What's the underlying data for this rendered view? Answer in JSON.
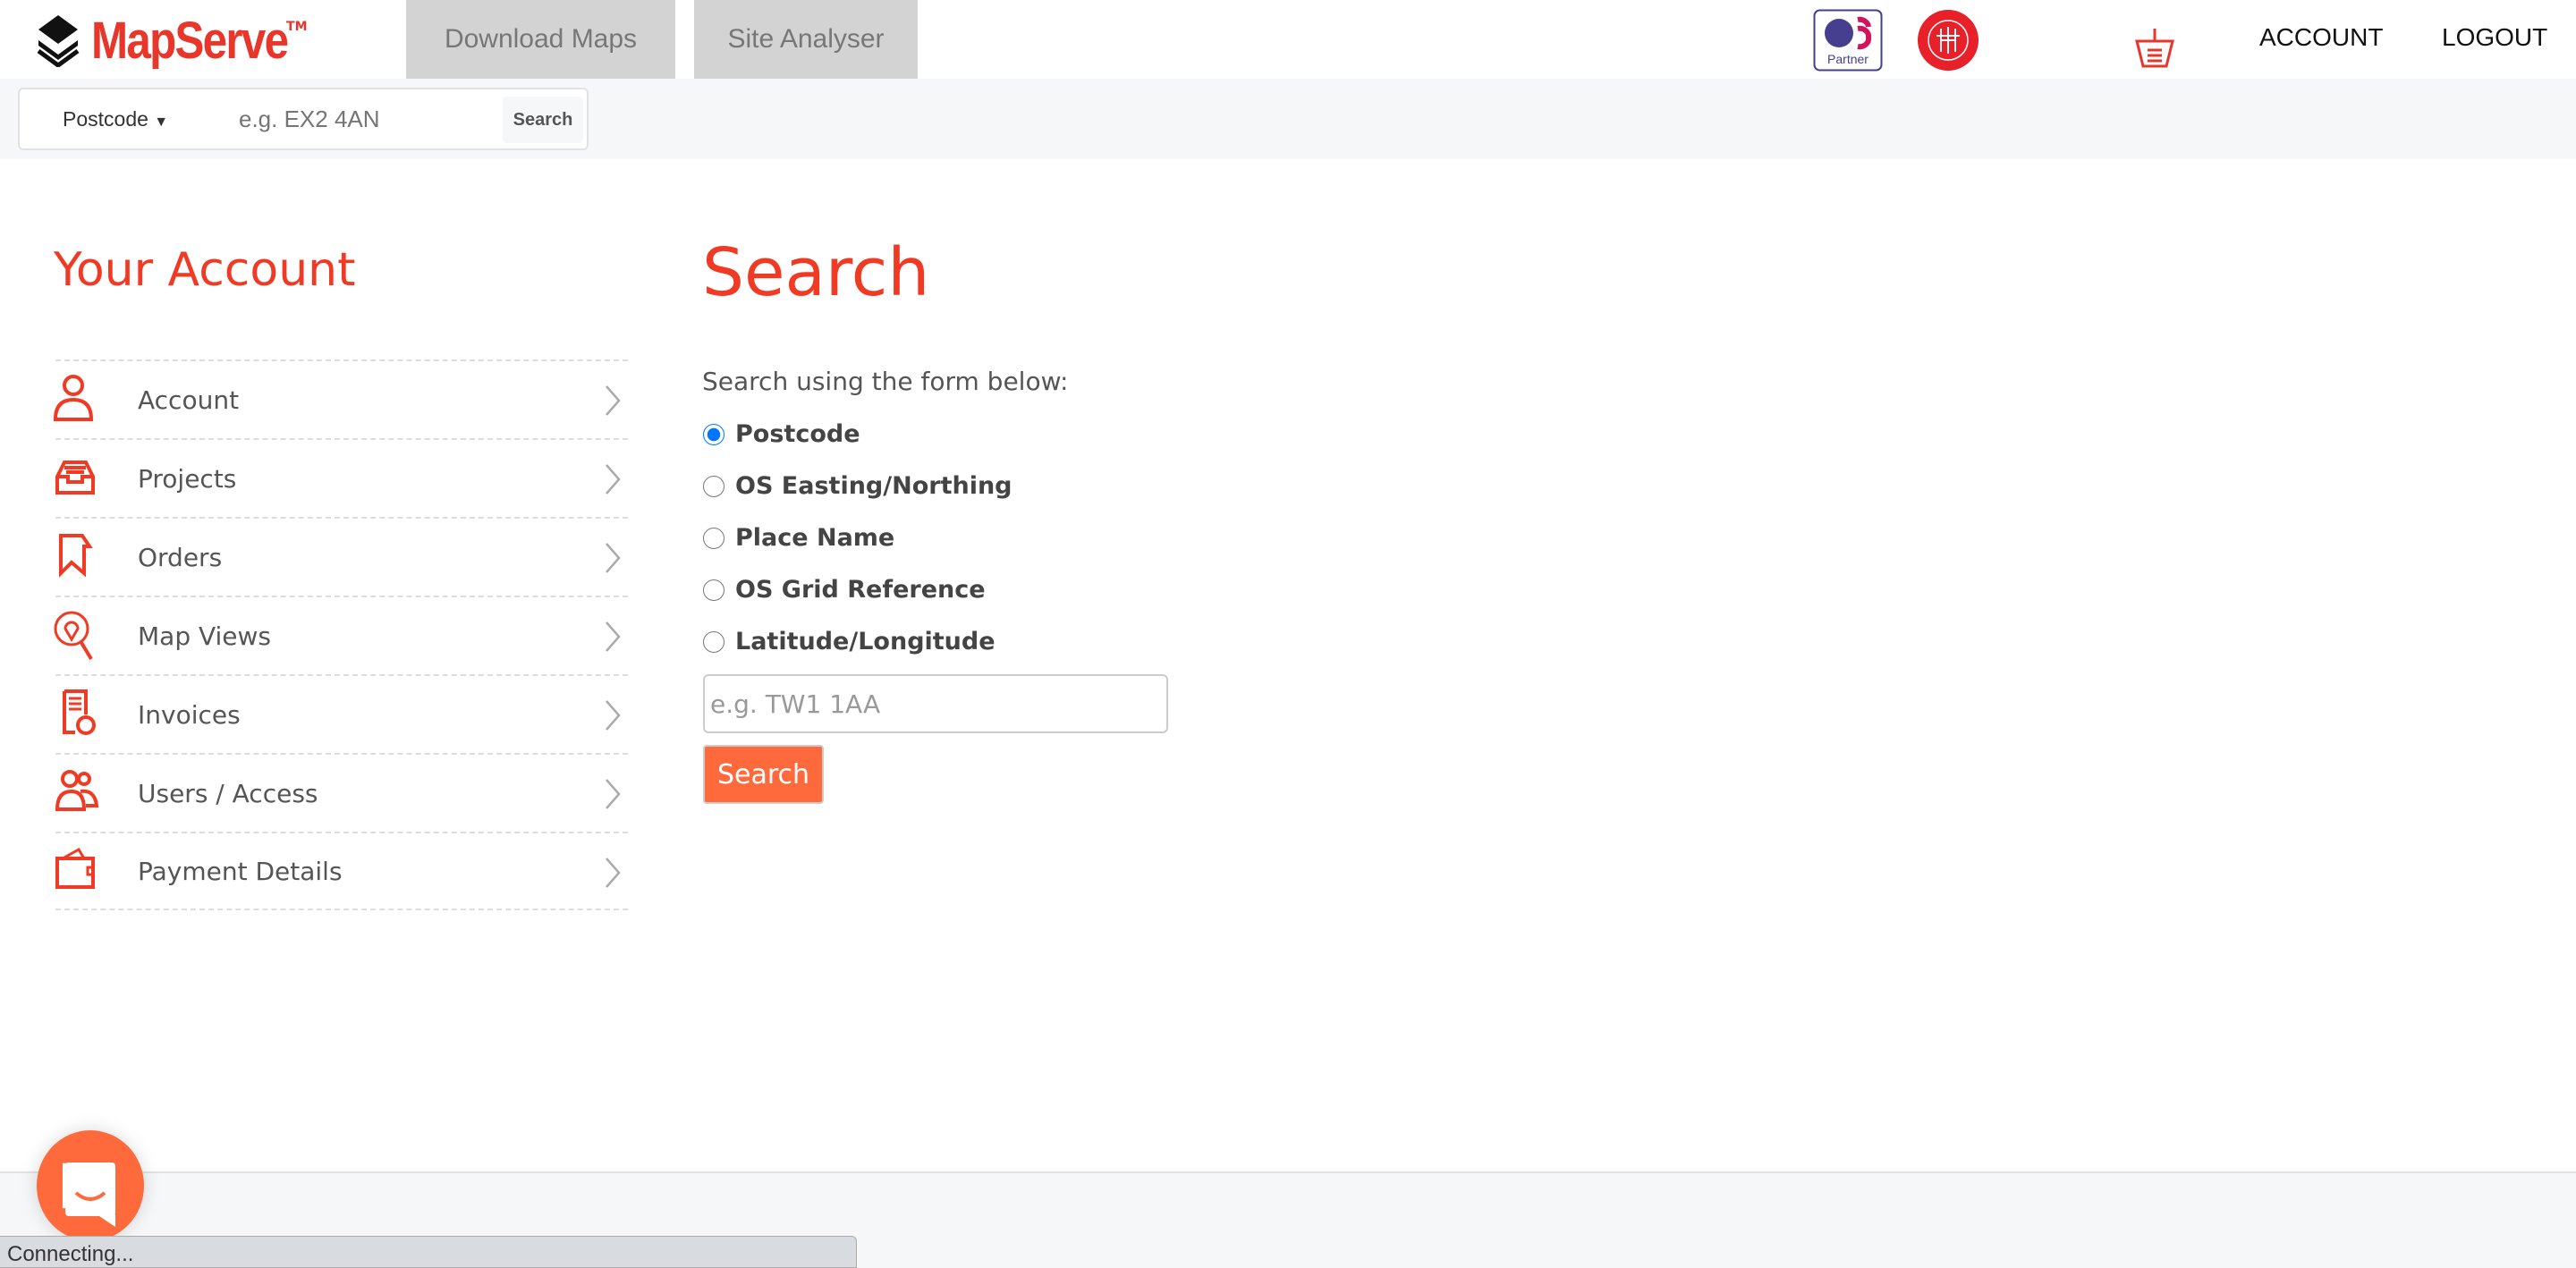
{
  "header": {
    "brand": "MapServe",
    "brand_tm": "TM",
    "tabs": [
      {
        "label": "Download Maps"
      },
      {
        "label": "Site Analyser"
      }
    ],
    "partner_logo": "OS Partner",
    "riba_logo": "RIBA CPD ASSESSED MATERIAL",
    "basket_icon": "basket-icon",
    "account_link": "ACCOUNT",
    "logout_link": "LOGOUT"
  },
  "quick_search": {
    "type": "Postcode",
    "placeholder": "e.g. EX2 4AN",
    "button": "Search"
  },
  "sidebar": {
    "title": "Your Account",
    "items": [
      {
        "label": "Account",
        "icon": "user-icon"
      },
      {
        "label": "Projects",
        "icon": "inbox-tray-icon"
      },
      {
        "label": "Orders",
        "icon": "bookmark-icon"
      },
      {
        "label": "Map Views",
        "icon": "map-pin-search-icon"
      },
      {
        "label": "Invoices",
        "icon": "invoice-coins-icon"
      },
      {
        "label": "Users / Access",
        "icon": "users-icon"
      },
      {
        "label": "Payment Details",
        "icon": "wallet-icon"
      }
    ]
  },
  "main": {
    "title": "Search",
    "intro": "Search using the form below:",
    "options": [
      {
        "label": "Postcode",
        "checked": true
      },
      {
        "label": "OS Easting/Northing",
        "checked": false
      },
      {
        "label": "Place Name",
        "checked": false
      },
      {
        "label": "OS Grid Reference",
        "checked": false
      },
      {
        "label": "Latitude/Longitude",
        "checked": false
      }
    ],
    "input_placeholder": "e.g. TW1 1AA",
    "button": "Search"
  },
  "status_bar": "Connecting...",
  "colors": {
    "brand_red": "#f03a24",
    "accent_orange": "#ff6a3d",
    "tab_grey": "#d3d3d3",
    "radio_blue": "#1a73e8"
  }
}
